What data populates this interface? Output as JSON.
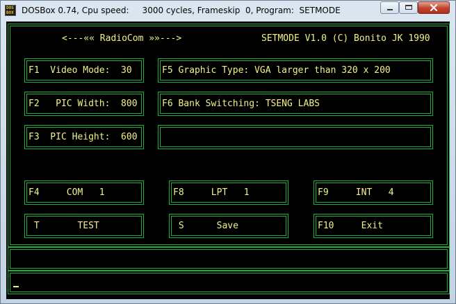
{
  "window": {
    "title": "DOSBox 0.74, Cpu speed:     3000 cycles, Frameskip  0, Program:  SETMODE",
    "icon_line1": "DOS",
    "icon_line2": "BOX",
    "icons": {
      "app": "dosbox-icon",
      "minimize": "minimize-icon",
      "maximize": "maximize-icon",
      "close": "close-icon"
    }
  },
  "header": {
    "left": "<---«« RadioCom »»--->",
    "right": "SETMODE V1.0 (C) Bonito JK 1990"
  },
  "fields": {
    "video_mode": "F1  Video Mode:  30",
    "pic_width": "F2   PIC Width:  800",
    "pic_height": "F3  PIC Height:  600",
    "graphic_type": "F5 Graphic Type: VGA larger than 320 x 200",
    "bank_switching": "F6 Bank Switching: TSENG LABS",
    "empty_field": ""
  },
  "buttons": {
    "com": "F4     COM   1",
    "lpt": "F8     LPT   1",
    "int": "F9     INT   4",
    "test": " T       TEST",
    "save": " S      Save",
    "exit": "F10     Exit"
  },
  "status": {
    "line1": "",
    "line2": ""
  },
  "colors": {
    "screen_bg": "#000000",
    "border": "#1fae3a",
    "text": "#f2f28a"
  }
}
